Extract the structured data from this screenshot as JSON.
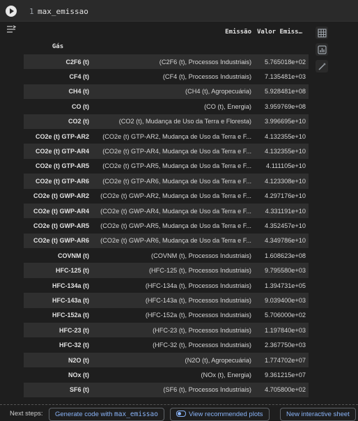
{
  "code_cell": {
    "line_number": "1",
    "code": "max_emissao"
  },
  "table": {
    "column_headers": [
      "Emissão",
      "Valor Emissão"
    ],
    "index_name": "Gás",
    "rows": [
      {
        "gas": "C2F6 (t)",
        "emissao": "(C2F6 (t), Processos Industriais)",
        "valor": "5.765018e+02"
      },
      {
        "gas": "CF4 (t)",
        "emissao": "(CF4 (t), Processos Industriais)",
        "valor": "7.135481e+03"
      },
      {
        "gas": "CH4 (t)",
        "emissao": "(CH4 (t), Agropecuária)",
        "valor": "5.928481e+08"
      },
      {
        "gas": "CO (t)",
        "emissao": "(CO (t), Energia)",
        "valor": "3.959769e+08"
      },
      {
        "gas": "CO2 (t)",
        "emissao": "(CO2 (t), Mudança de Uso da Terra e Floresta)",
        "valor": "3.996695e+10"
      },
      {
        "gas": "CO2e (t) GTP-AR2",
        "emissao": "(CO2e (t) GTP-AR2, Mudança de Uso da Terra e F...",
        "valor": "4.132355e+10"
      },
      {
        "gas": "CO2e (t) GTP-AR4",
        "emissao": "(CO2e (t) GTP-AR4, Mudança de Uso da Terra e F...",
        "valor": "4.132355e+10"
      },
      {
        "gas": "CO2e (t) GTP-AR5",
        "emissao": "(CO2e (t) GTP-AR5, Mudança de Uso da Terra e F...",
        "valor": "4.111105e+10"
      },
      {
        "gas": "CO2e (t) GTP-AR6",
        "emissao": "(CO2e (t) GTP-AR6, Mudança de Uso da Terra e F...",
        "valor": "4.123308e+10"
      },
      {
        "gas": "CO2e (t) GWP-AR2",
        "emissao": "(CO2e (t) GWP-AR2, Mudança de Uso da Terra e F...",
        "valor": "4.297176e+10"
      },
      {
        "gas": "CO2e (t) GWP-AR4",
        "emissao": "(CO2e (t) GWP-AR4, Mudança de Uso da Terra e F...",
        "valor": "4.331191e+10"
      },
      {
        "gas": "CO2e (t) GWP-AR5",
        "emissao": "(CO2e (t) GWP-AR5, Mudança de Uso da Terra e F...",
        "valor": "4.352457e+10"
      },
      {
        "gas": "CO2e (t) GWP-AR6",
        "emissao": "(CO2e (t) GWP-AR6, Mudança de Uso da Terra e F...",
        "valor": "4.349786e+10"
      },
      {
        "gas": "COVNM (t)",
        "emissao": "(COVNM (t), Processos Industriais)",
        "valor": "1.608623e+08"
      },
      {
        "gas": "HFC-125 (t)",
        "emissao": "(HFC-125 (t), Processos Industriais)",
        "valor": "9.795580e+03"
      },
      {
        "gas": "HFC-134a (t)",
        "emissao": "(HFC-134a (t), Processos Industriais)",
        "valor": "1.394731e+05"
      },
      {
        "gas": "HFC-143a (t)",
        "emissao": "(HFC-143a (t), Processos Industriais)",
        "valor": "9.039400e+03"
      },
      {
        "gas": "HFC-152a (t)",
        "emissao": "(HFC-152a (t), Processos Industriais)",
        "valor": "5.706000e+02"
      },
      {
        "gas": "HFC-23 (t)",
        "emissao": "(HFC-23 (t), Processos Industriais)",
        "valor": "1.197840e+03"
      },
      {
        "gas": "HFC-32 (t)",
        "emissao": "(HFC-32 (t), Processos Industriais)",
        "valor": "2.367750e+03"
      },
      {
        "gas": "N2O (t)",
        "emissao": "(N2O (t), Agropecuária)",
        "valor": "1.774702e+07"
      },
      {
        "gas": "NOx (t)",
        "emissao": "(NOx (t), Energia)",
        "valor": "9.361215e+07"
      },
      {
        "gas": "SF6 (t)",
        "emissao": "(SF6 (t), Processos Industriais)",
        "valor": "4.705800e+02"
      }
    ]
  },
  "side_actions": [
    {
      "icon": "table-icon"
    },
    {
      "icon": "bar-chart-icon"
    },
    {
      "icon": "magic-wand-icon"
    }
  ],
  "next_steps": {
    "label": "Next steps:",
    "generate_prefix": "Generate code with",
    "generate_var": "max_emissao",
    "recommended_plots": "View recommended plots",
    "interactive_sheet": "New interactive sheet"
  },
  "colors": {
    "background": "#1e1e1e",
    "stripe": "#2f2f2f",
    "link": "#8ab4f8"
  }
}
